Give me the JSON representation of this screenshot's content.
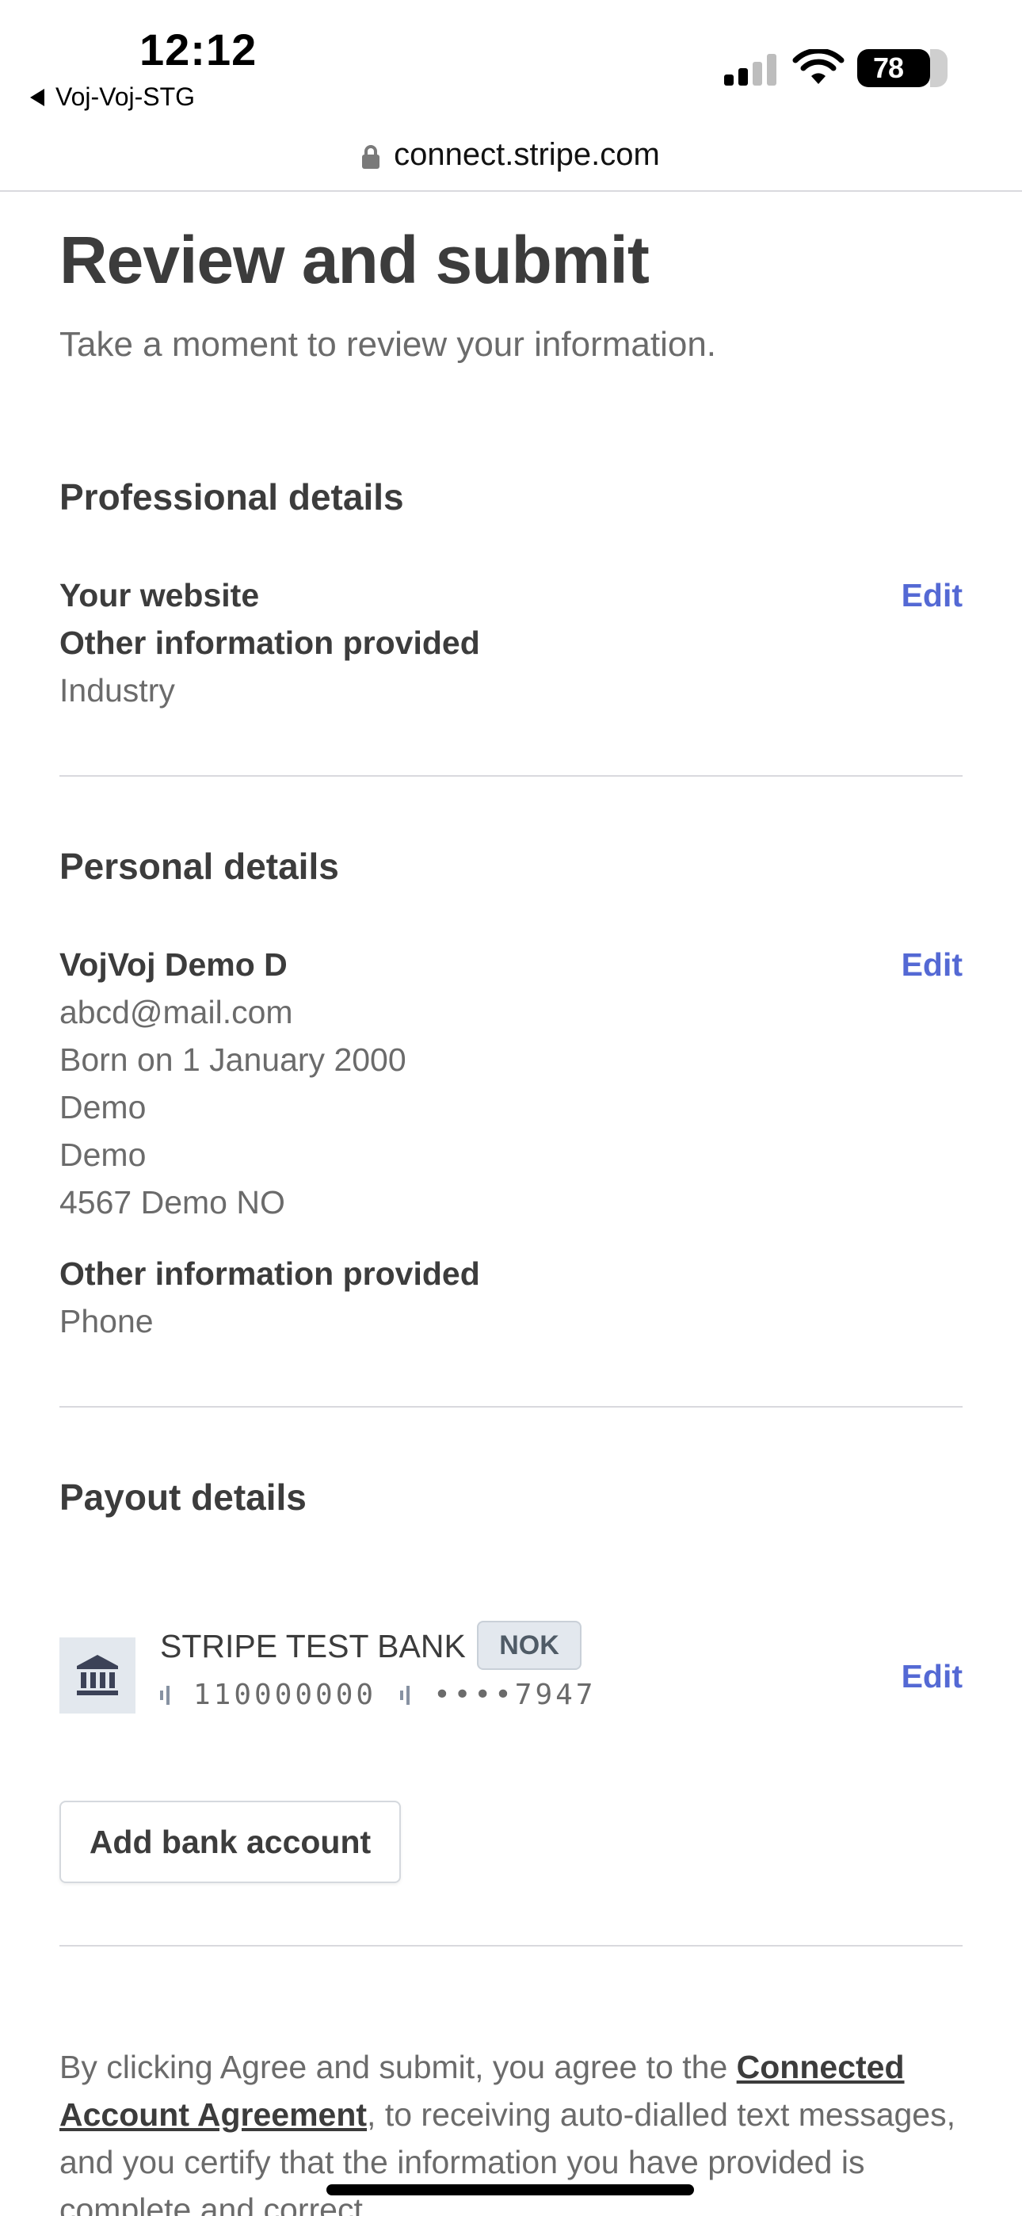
{
  "status_bar": {
    "time": "12:12",
    "back_app": "Voj-Voj-STG",
    "battery": "78"
  },
  "browser": {
    "url": "connect.stripe.com"
  },
  "page": {
    "title": "Review and submit",
    "subtitle": "Take a moment to review your information."
  },
  "professional": {
    "title": "Professional details",
    "website_label": "Your website",
    "other_label": "Other information provided",
    "other_value": "Industry",
    "edit_label": "Edit"
  },
  "personal": {
    "title": "Personal details",
    "name": "VojVoj Demo D",
    "email": "abcd@mail.com",
    "birth": "Born on 1 January 2000",
    "address_line1": "Demo",
    "address_line2": "Demo",
    "address_line3": "4567 Demo NO",
    "other_label": "Other information provided",
    "other_value": "Phone",
    "edit_label": "Edit"
  },
  "payout": {
    "title": "Payout details",
    "bank_name": "STRIPE TEST BANK",
    "currency": "NOK",
    "routing_number": "110000000",
    "account_number": "••••7947",
    "edit_label": "Edit",
    "add_bank_label": "Add bank account"
  },
  "agreement": {
    "prefix": "By clicking Agree and submit, you agree to the ",
    "link_text": "Connected Account Agreement",
    "suffix": ", to receiving auto-dialled text messages, and you certify that the information you have provided is complete and correct."
  },
  "colors": {
    "link": "#5469d4",
    "badge_bg": "#e3e8ee"
  }
}
